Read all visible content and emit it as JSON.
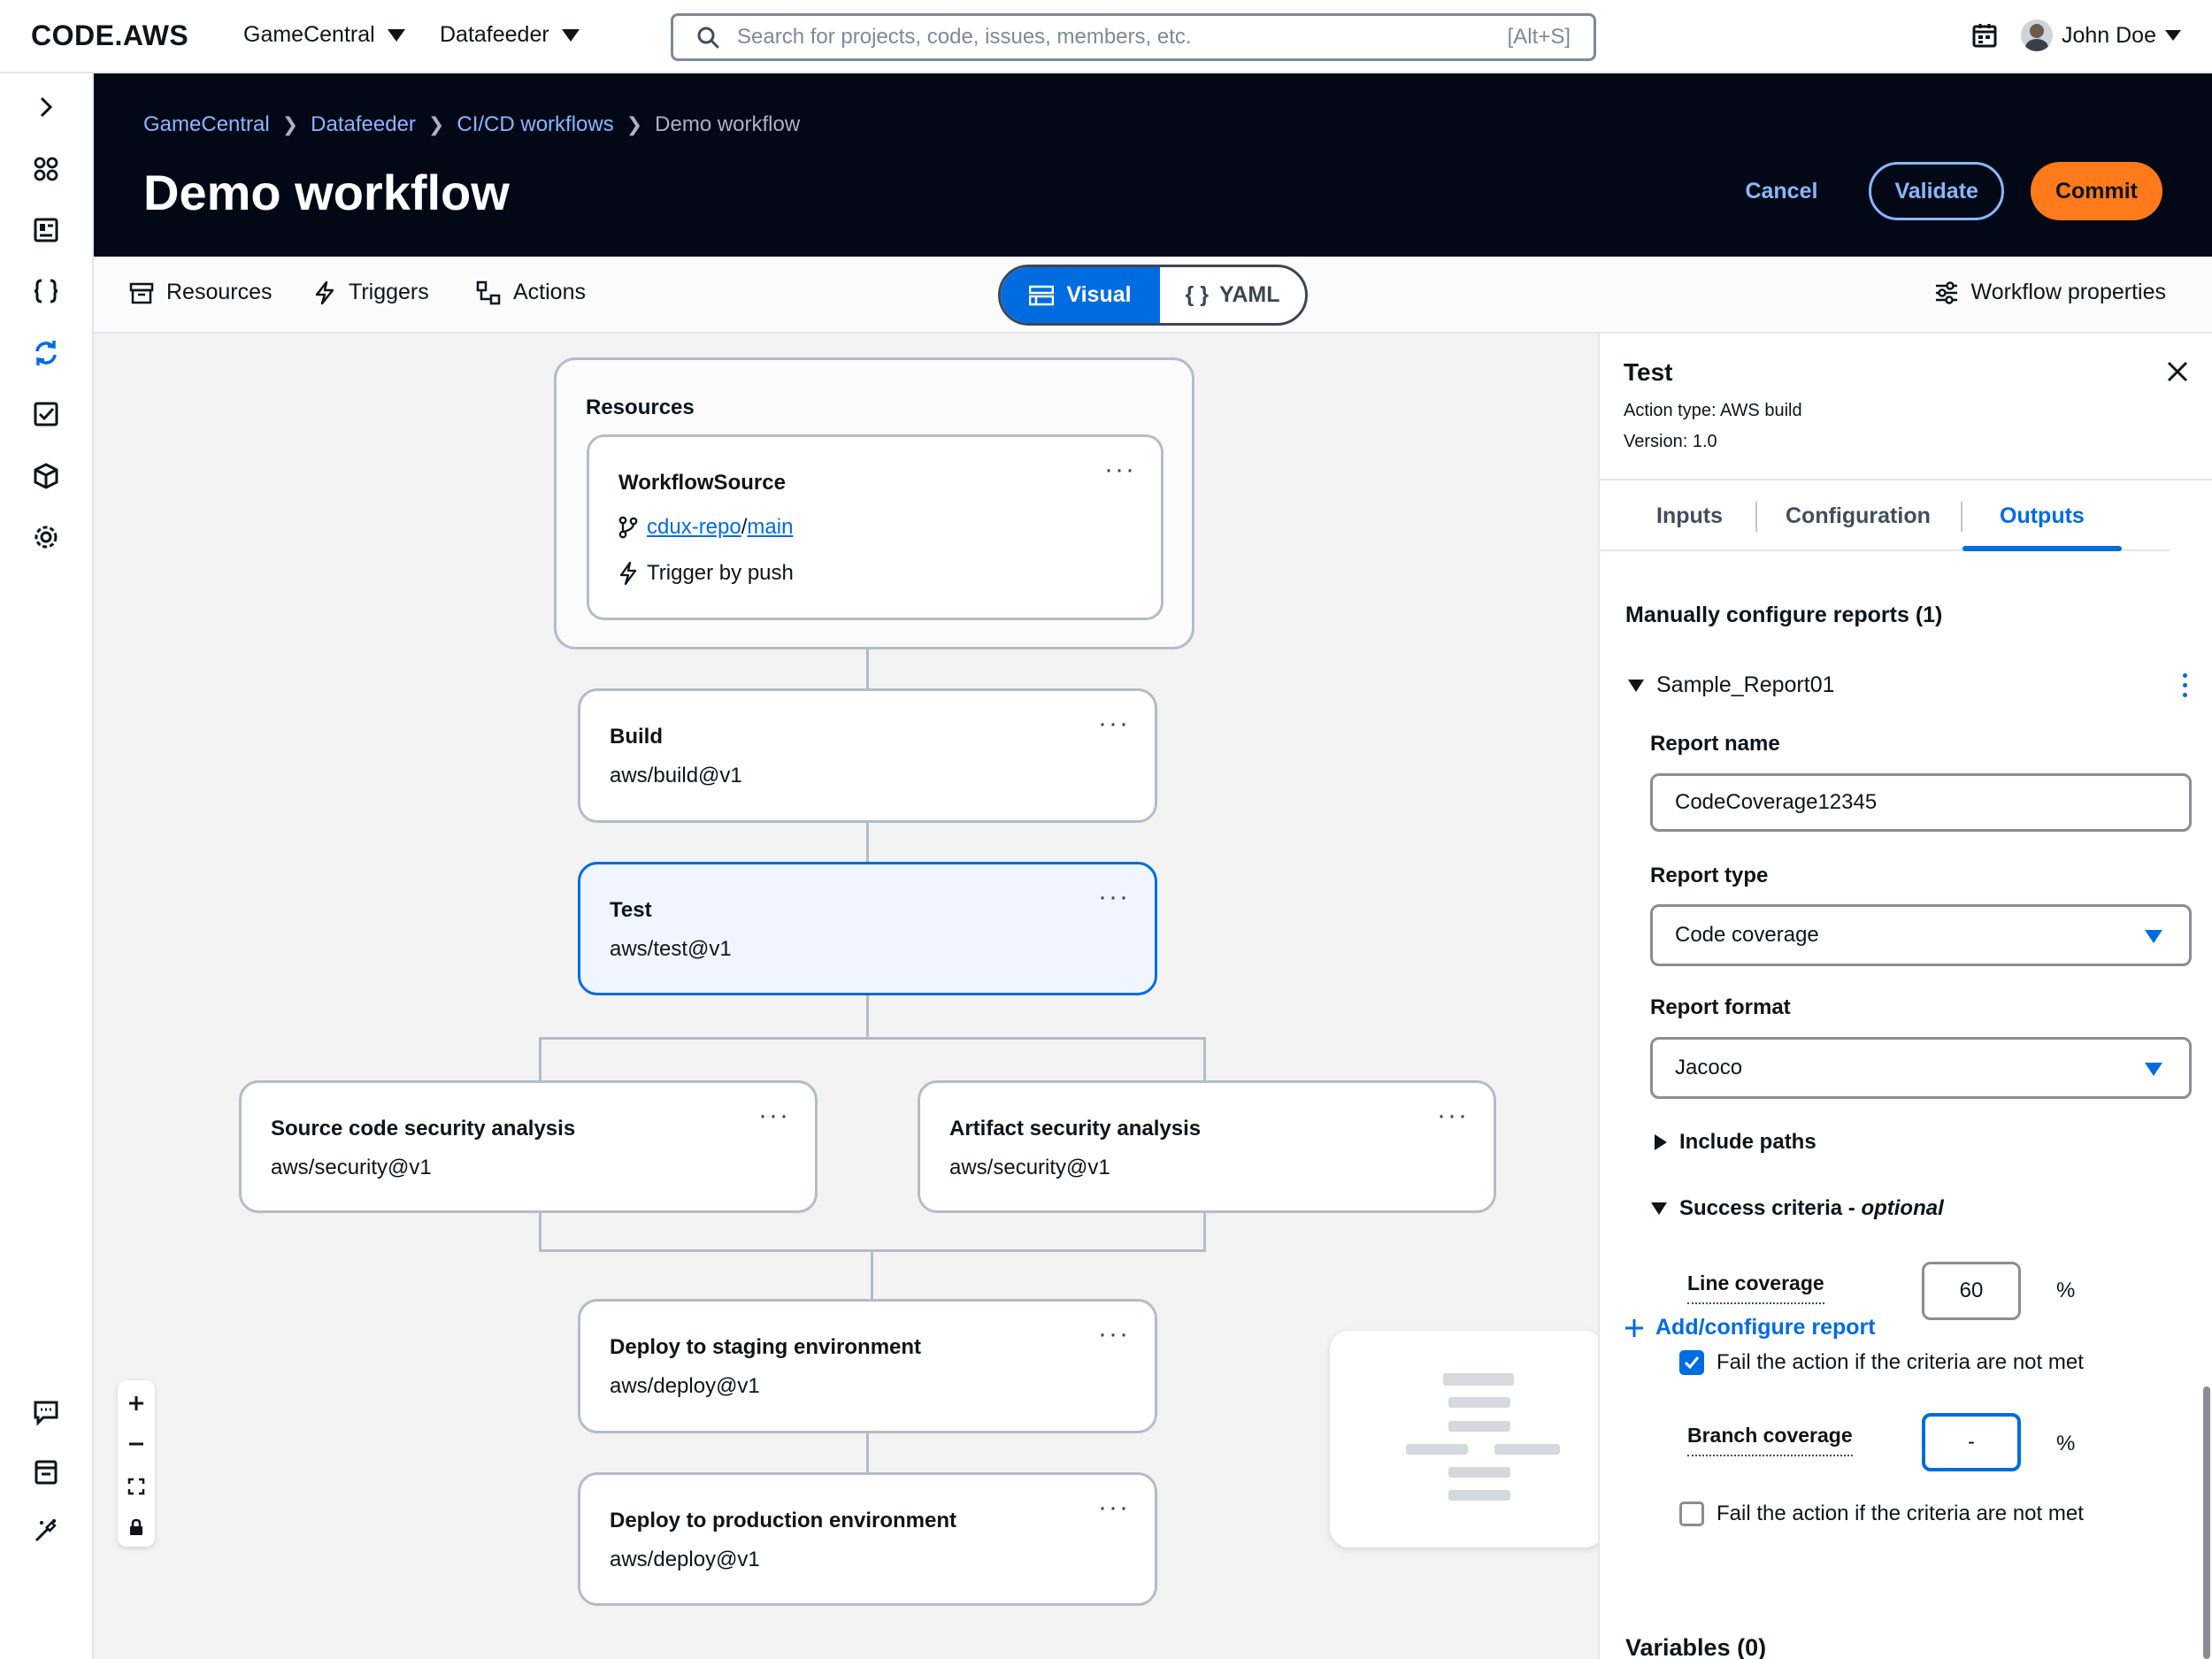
{
  "topbar": {
    "logo": "CODE.AWS",
    "project_dropdown": "GameCentral",
    "repo_dropdown": "Datafeeder",
    "search_placeholder": "Search for projects, code, issues, members, etc.",
    "search_shortcut": "[Alt+S]",
    "user_name": "John Doe"
  },
  "header": {
    "breadcrumbs": [
      "GameCentral",
      "Datafeeder",
      "CI/CD workflows",
      "Demo workflow"
    ],
    "title": "Demo workflow",
    "cancel_label": "Cancel",
    "validate_label": "Validate",
    "commit_label": "Commit"
  },
  "toolbar": {
    "resources_label": "Resources",
    "triggers_label": "Triggers",
    "actions_label": "Actions",
    "visual_label": "Visual",
    "yaml_label": "YAML",
    "properties_label": "Workflow properties"
  },
  "canvas": {
    "resources_title": "Resources",
    "source_title": "WorkflowSource",
    "repo_link": "cdux-repo",
    "branch_link": "main",
    "repo_separator": "/",
    "trigger_text": "Trigger by push",
    "nodes": {
      "build": {
        "title": "Build",
        "subtitle": "aws/build@v1"
      },
      "test": {
        "title": "Test",
        "subtitle": "aws/test@v1"
      },
      "source_security": {
        "title": "Source code security analysis",
        "subtitle": "aws/security@v1"
      },
      "artifact_security": {
        "title": "Artifact security analysis",
        "subtitle": "aws/security@v1"
      },
      "deploy_staging": {
        "title": "Deploy to staging environment",
        "subtitle": "aws/deploy@v1"
      },
      "deploy_production": {
        "title": "Deploy to production environment",
        "subtitle": "aws/deploy@v1"
      }
    },
    "more_glyph": "···"
  },
  "panel": {
    "title": "Test",
    "action_type": "Action type: AWS build",
    "version": "Version: 1.0",
    "tabs": [
      "Inputs",
      "Configuration",
      "Outputs"
    ],
    "active_tab": "Outputs",
    "reports_heading": "Manually configure reports (1)",
    "report_item": "Sample_Report01",
    "report_name_label": "Report name",
    "report_name_value": "CodeCoverage12345",
    "report_type_label": "Report type",
    "report_type_value": "Code coverage",
    "report_format_label": "Report format",
    "report_format_value": "Jacoco",
    "include_paths": "Include paths",
    "success_criteria": "Success criteria - ",
    "success_optional": "optional",
    "line_coverage_label": "Line coverage",
    "line_coverage_value": "60",
    "branch_coverage_label": "Branch coverage",
    "branch_coverage_value": "-",
    "percent": "%",
    "fail_label": "Fail the action if the criteria are not met",
    "line_fail_checked": true,
    "branch_fail_checked": false,
    "add_report": "Add/configure report",
    "variables_heading": "Variables (0)"
  },
  "colors": {
    "accent": "#006ce0",
    "commit": "#ff7a1a",
    "header_bg": "#030816"
  },
  "icons": {
    "rail": [
      "chevron-right-icon",
      "grid-icon",
      "board-icon",
      "code-braces-icon",
      "sync-icon",
      "checklist-icon",
      "package-icon",
      "gear-icon",
      "feedback-icon",
      "archive-icon",
      "magic-wand-icon"
    ],
    "zoom": [
      "plus-icon",
      "minus-icon",
      "fit-screen-icon",
      "lock-icon"
    ]
  }
}
